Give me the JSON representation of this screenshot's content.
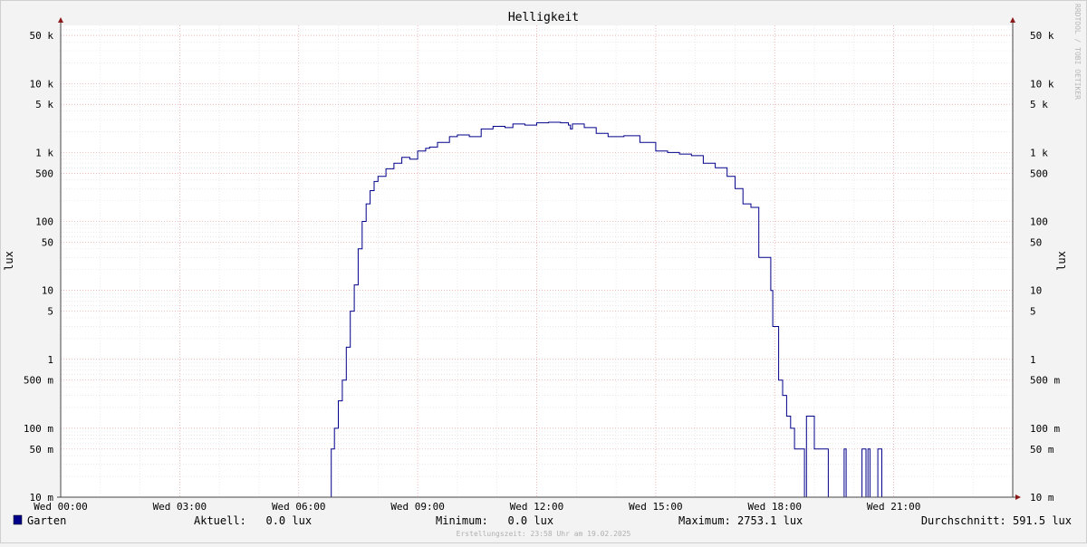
{
  "chart_data": {
    "type": "line",
    "title": "Helligkeit",
    "ylabel": "lux",
    "yscale": "log",
    "ylim": [
      0.01,
      70000
    ],
    "xlim": [
      0,
      24
    ],
    "grid": true,
    "watermark": "RRDTOOL / TOBI OETIKER",
    "x_ticks": [
      {
        "value": 0,
        "label": "Wed 00:00"
      },
      {
        "value": 3,
        "label": "Wed 03:00"
      },
      {
        "value": 6,
        "label": "Wed 06:00"
      },
      {
        "value": 9,
        "label": "Wed 09:00"
      },
      {
        "value": 12,
        "label": "Wed 12:00"
      },
      {
        "value": 15,
        "label": "Wed 15:00"
      },
      {
        "value": 18,
        "label": "Wed 18:00"
      },
      {
        "value": 21,
        "label": "Wed 21:00"
      }
    ],
    "y_ticks": [
      {
        "value": 50000,
        "label": "50 k"
      },
      {
        "value": 10000,
        "label": "10 k"
      },
      {
        "value": 5000,
        "label": "5 k"
      },
      {
        "value": 1000,
        "label": "1 k"
      },
      {
        "value": 500,
        "label": "500"
      },
      {
        "value": 100,
        "label": "100"
      },
      {
        "value": 50,
        "label": "50"
      },
      {
        "value": 10,
        "label": "10"
      },
      {
        "value": 5,
        "label": "5"
      },
      {
        "value": 1,
        "label": "1"
      },
      {
        "value": 0.5,
        "label": "500 m"
      },
      {
        "value": 0.1,
        "label": "100 m"
      },
      {
        "value": 0.05,
        "label": "50 m"
      },
      {
        "value": 0.01,
        "label": "10 m"
      }
    ],
    "series": [
      {
        "name": "Garten",
        "color": "#00008b",
        "x": [
          0,
          6.8,
          6.82,
          6.9,
          7.0,
          7.1,
          7.2,
          7.3,
          7.4,
          7.5,
          7.6,
          7.7,
          7.8,
          7.9,
          8.0,
          8.2,
          8.4,
          8.6,
          8.8,
          9.0,
          9.2,
          9.3,
          9.5,
          9.8,
          10.0,
          10.3,
          10.6,
          10.9,
          11.2,
          11.4,
          11.7,
          12.0,
          12.3,
          12.6,
          12.8,
          12.85,
          12.9,
          13.2,
          13.5,
          13.8,
          14.2,
          14.6,
          15.0,
          15.3,
          15.6,
          15.9,
          16.2,
          16.5,
          16.8,
          17.0,
          17.2,
          17.4,
          17.55,
          17.6,
          17.9,
          17.95,
          18.1,
          18.2,
          18.3,
          18.4,
          18.5,
          18.6,
          18.7,
          18.75,
          18.8,
          19.0,
          19.3,
          19.35,
          19.45,
          19.5,
          19.7,
          19.75,
          19.8,
          20.1,
          20.2,
          20.3,
          20.35,
          20.4,
          20.5,
          20.6,
          20.7,
          20.8,
          20.9,
          21.0,
          21.5,
          22.0,
          24
        ],
        "values": [
          0.01,
          0.01,
          0.05,
          0.1,
          0.25,
          0.5,
          1.5,
          5,
          12,
          40,
          100,
          180,
          280,
          380,
          450,
          580,
          700,
          850,
          800,
          1050,
          1150,
          1200,
          1400,
          1700,
          1800,
          1700,
          2200,
          2400,
          2300,
          2600,
          2500,
          2700,
          2750,
          2700,
          2500,
          2200,
          2600,
          2300,
          1900,
          1700,
          1750,
          1400,
          1050,
          1000,
          950,
          900,
          700,
          600,
          450,
          300,
          180,
          160,
          160,
          30,
          10,
          3,
          0.5,
          0.3,
          0.15,
          0.1,
          0.05,
          0.05,
          0.05,
          0.01,
          0.15,
          0.05,
          0.05,
          0.01,
          0.01,
          0.01,
          0.01,
          0.05,
          0.01,
          0.01,
          0.05,
          0.01,
          0.05,
          0.01,
          0.01,
          0.05,
          0.01,
          0.01,
          0.01,
          0.01,
          0.01,
          0.01,
          0.01
        ]
      }
    ],
    "legend": {
      "placement": "bottom",
      "series_label": "Garten",
      "current": "Aktuell:   0.0 lux",
      "minimum": "Minimum:   0.0 lux",
      "maximum": "Maximum: 2753.1 lux",
      "average": "Durchschnitt: 591.5 lux"
    },
    "footer": "Erstellungszeit: 23:58 Uhr am 19.02.2025"
  }
}
